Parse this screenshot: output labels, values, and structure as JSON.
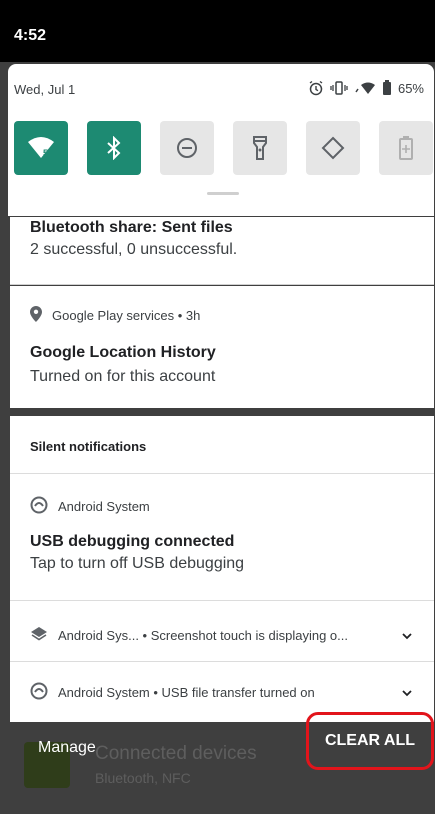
{
  "status_bar": {
    "time": "4:52"
  },
  "quick_settings": {
    "date": "Wed, Jul 1",
    "battery": "65%",
    "tiles": [
      {
        "name": "wifi",
        "on": true,
        "badge": "5"
      },
      {
        "name": "bluetooth",
        "on": true
      },
      {
        "name": "do-not-disturb",
        "on": false
      },
      {
        "name": "flashlight",
        "on": false
      },
      {
        "name": "auto-rotate",
        "on": false
      },
      {
        "name": "battery-saver",
        "on": false
      }
    ]
  },
  "notifications": {
    "bluetooth_share": {
      "title": "Bluetooth share: Sent files",
      "text": "2 successful, 0 unsuccessful."
    },
    "google_location": {
      "app": "Google Play services • 3h",
      "title": "Google Location History",
      "text": "Turned on for this account"
    },
    "silent_header": "Silent notifications",
    "usb_debugging": {
      "app": "Android System",
      "title": "USB debugging connected",
      "text": "Tap to turn off USB debugging"
    },
    "screenshot_touch": {
      "summary": "Android Sys... • Screenshot touch is displaying o..."
    },
    "usb_transfer": {
      "summary": "Android System • USB file transfer turned on"
    }
  },
  "footer": {
    "manage": "Manage",
    "clear_all": "CLEAR ALL",
    "background_title": "Connected devices",
    "background_sub": "Bluetooth, NFC"
  },
  "colors": {
    "accent": "#1d8a72",
    "highlight": "#e2141b"
  }
}
